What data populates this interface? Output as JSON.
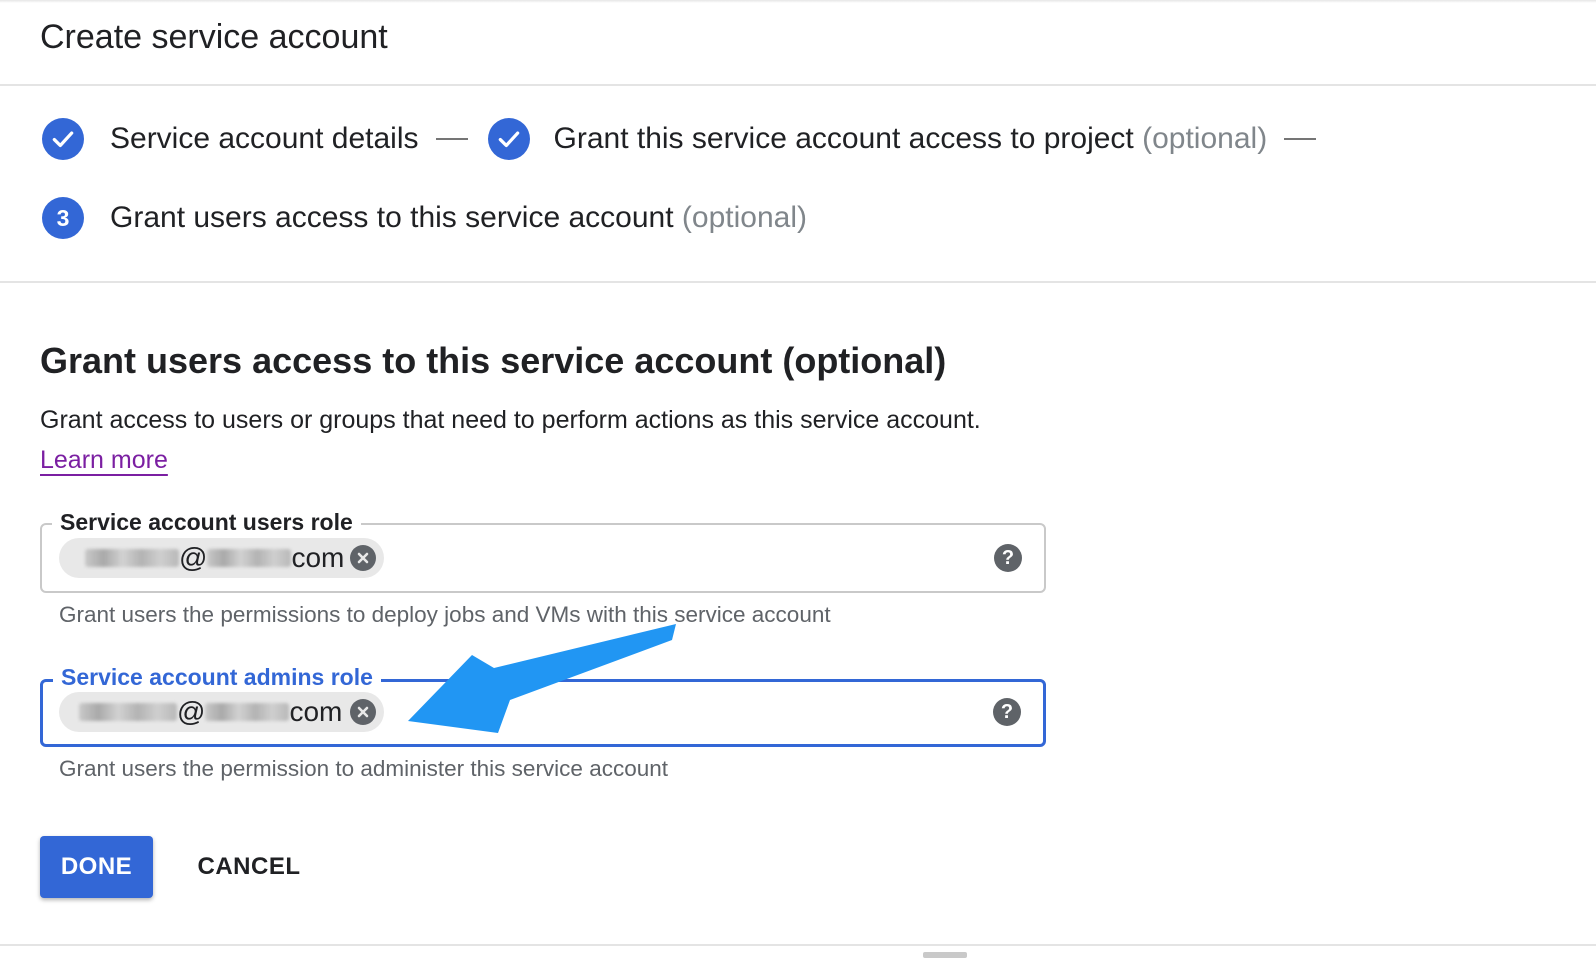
{
  "page": {
    "title": "Create service account"
  },
  "stepper": {
    "steps": [
      {
        "label": "Service account details",
        "optional": "",
        "status": "complete",
        "icon": "check-icon"
      },
      {
        "label": "Grant this service account access to project",
        "optional": "(optional)",
        "status": "complete",
        "icon": "check-icon"
      },
      {
        "label": "Grant users access to this service account",
        "optional": "(optional)",
        "status": "current",
        "number": "3"
      }
    ]
  },
  "section": {
    "heading": "Grant users access to this service account (optional)",
    "description": "Grant access to users or groups that need to perform actions as this service account.",
    "learn_more": "Learn more"
  },
  "fields": {
    "users_role": {
      "label": "Service account users role",
      "chip_at": "@",
      "chip_suffix": "com",
      "hint": "Grant users the permissions to deploy jobs and VMs with this service account",
      "help_icon": "?"
    },
    "admins_role": {
      "label": "Service account admins role",
      "chip_at": "@",
      "chip_suffix": "com",
      "hint": "Grant users the permission to administer this service account",
      "help_icon": "?"
    }
  },
  "buttons": {
    "done": "DONE",
    "cancel": "CANCEL"
  },
  "colors": {
    "accent": "#3367d6",
    "link": "#7b1fa2",
    "annotation": "#2196f3"
  }
}
